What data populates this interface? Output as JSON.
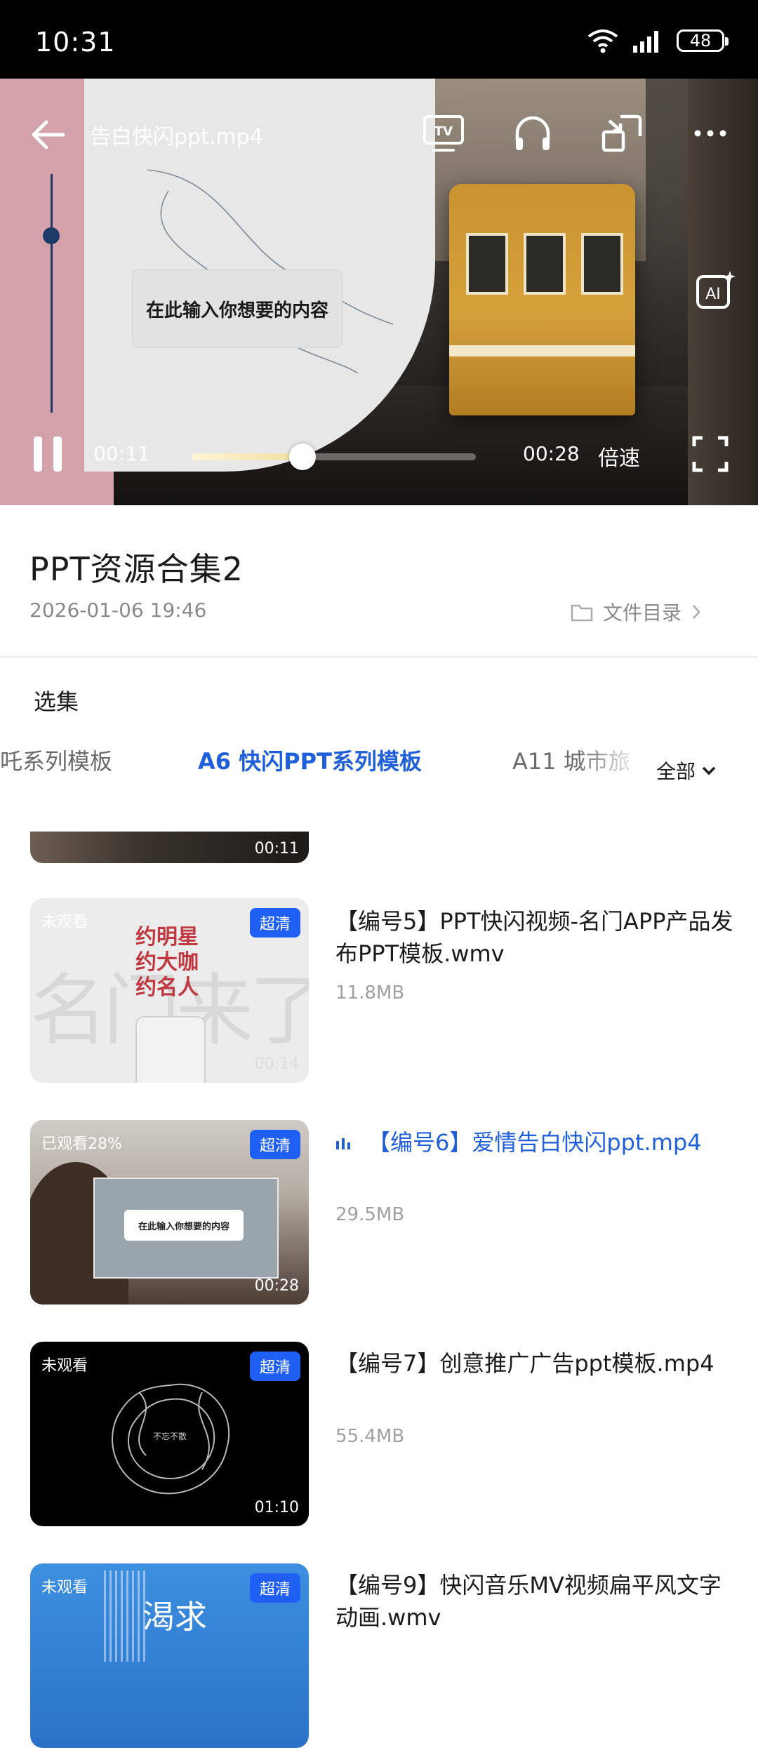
{
  "status_bar": {
    "time": "10:31",
    "battery": "48"
  },
  "player": {
    "title": "告白快闪ppt.mp4",
    "overlay_text": "在此输入你想要的内容",
    "current_time": "00:11",
    "total_time": "00:28",
    "speed_label": "倍速",
    "progress_fraction": 0.39,
    "ai_label": "AI"
  },
  "info": {
    "title": "PPT资源合集2",
    "date": "2026-01-06 19:46",
    "dir_label": "文件目录"
  },
  "episodes_section": {
    "label": "选集",
    "tabs": [
      "吒系列模板",
      "A6  快闪PPT系列模板",
      "A11  城市旅"
    ],
    "active_tab_index": 1,
    "all_label": "全部"
  },
  "episodes": [
    {
      "partial": true,
      "duration": "00:11"
    },
    {
      "watch": "未观看",
      "hd": "超清",
      "duration": "00:14",
      "title": "【编号5】PPT快闪视频-名门APP产品发布PPT模板.wmv",
      "size": "11.8MB",
      "thumb_texts": [
        "约明星",
        "约大咖",
        "约名人"
      ]
    },
    {
      "watch": "已观看28%",
      "hd": "超清",
      "duration": "00:28",
      "title": "【编号6】爱情告白快闪ppt.mp4",
      "size": "29.5MB",
      "playing": true,
      "thumb_text": "在此输入你想要的内容"
    },
    {
      "watch": "未观看",
      "hd": "超清",
      "duration": "01:10",
      "title": "【编号7】创意推广广告ppt模板.mp4",
      "size": "55.4MB",
      "thumb_text": "不忘不散"
    },
    {
      "watch": "未观看",
      "hd": "超清",
      "title": "【编号9】快闪音乐MV视频扁平风文字动画.wmv",
      "thumb_text": "渴求"
    }
  ],
  "colors": {
    "accent": "#1f5fd9",
    "hd_badge": "#1f5ff3",
    "muted": "#8a8a8a"
  }
}
